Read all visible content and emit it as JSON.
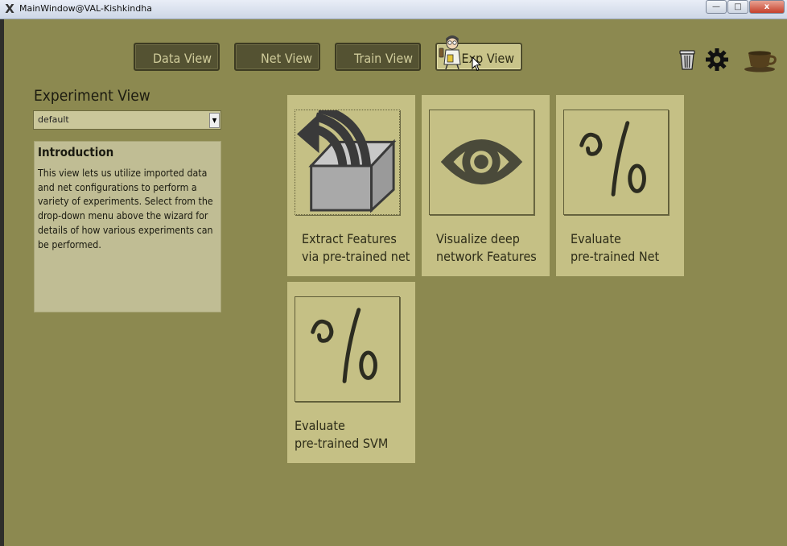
{
  "window": {
    "title": "MainWindow@VAL-Kishkindha",
    "controls": [
      "—",
      "□",
      "x"
    ]
  },
  "nav": [
    {
      "label": "Data View",
      "active": false
    },
    {
      "label": "Net View",
      "active": false
    },
    {
      "label": "Train View",
      "active": false
    },
    {
      "label": "Exp View",
      "active": true
    }
  ],
  "toolbar_icons": [
    "trash-icon",
    "gear-icon",
    "coffee-cup-icon"
  ],
  "panel": {
    "title": "Experiment View",
    "dropdown_value": "default",
    "intro_heading": "Introduction",
    "intro_lines": [
      "This view lets us utilize imported data",
      "and net configurations to perform a",
      "variety of experiments. Select from the",
      "drop-down menu above the wizard for",
      "details of how various experiments can",
      "be performed."
    ]
  },
  "cards": [
    {
      "icon": "extract-features-icon",
      "line1": "Extract  Features",
      "line2": "via pre-trained net"
    },
    {
      "icon": "eye-icon",
      "line1": "Visualize deep",
      "line2": "network Features"
    },
    {
      "icon": "percent-icon",
      "line1": "Evaluate",
      "line2": "pre-trained Net"
    },
    {
      "icon": "percent-icon",
      "line1": "Evaluate",
      "line2": "pre-trained SVM"
    }
  ]
}
